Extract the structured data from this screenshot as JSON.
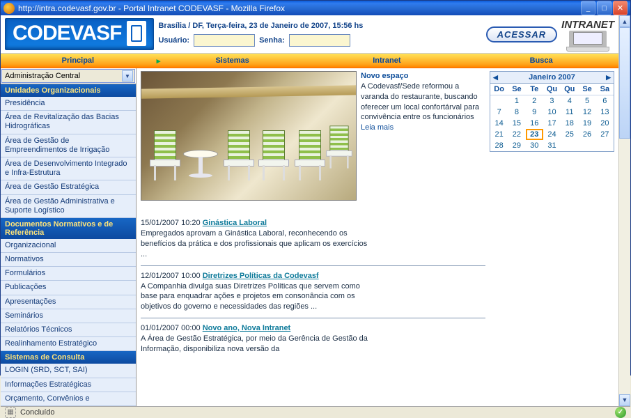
{
  "window": {
    "title": "http://intra.codevasf.gov.br - Portal Intranet CODEVASF - Mozilla Firefox"
  },
  "header": {
    "logo_text": "CODEVASF",
    "location": "Brasília / DF, Terça-feira, 23 de Janeiro de 2007, 15:56 hs",
    "user_label": "Usuário:",
    "pass_label": "Senha:",
    "login_button": "ACESSAR",
    "intranet_tag": "INTRANET"
  },
  "nav": {
    "items": [
      "Principal",
      "Sistemas",
      "Intranet",
      "Busca"
    ]
  },
  "sidebar": {
    "select_value": "Administração Central",
    "sections": [
      {
        "heading": "Unidades Organizacionais",
        "items": [
          "Presidência",
          "Área de Revitalização das Bacias Hidrográficas",
          "Área de Gestão de Empreendimentos de Irrigação",
          "Área de Desenvolvimento Integrado e Infra-Estrutura",
          "Área de Gestão Estratégica",
          "Área de Gestão Administrativa e Suporte Logístico"
        ]
      },
      {
        "heading": "Documentos Normativos e de Referência",
        "items": [
          "Organizacional",
          "Normativos",
          "Formulários",
          "Publicações",
          "Apresentações",
          "Seminários",
          "Relatórios Técnicos",
          "Realinhamento Estratégico"
        ]
      },
      {
        "heading": "Sistemas de Consulta",
        "items": [
          "LOGIN (SRD, SCT, SAI)",
          "Informações Estratégicas",
          "Orçamento, Convênios e"
        ]
      }
    ]
  },
  "lead": {
    "title": "Novo espaço",
    "body": "A Codevasf/Sede reformou a varanda do restaurante, buscando oferecer um local confortárval para convivência entre os funcionários",
    "more": "Leia mais"
  },
  "news": [
    {
      "dt": "15/01/2007 10:20",
      "hl": "Ginástica Laboral",
      "body": "Empregados aprovam a Ginástica Laboral, reconhecendo os benefícios da prática e dos profissionais que aplicam os exercícios ..."
    },
    {
      "dt": "12/01/2007 10:00",
      "hl": "Diretrizes Políticas da Codevasf",
      "body": "A Companhia divulga suas Diretrizes Políticas que servem como base para enquadrar ações e projetos em consonância com os objetivos do governo e necessidades das regiões ..."
    },
    {
      "dt": "01/01/2007 00:00",
      "hl": "Novo ano, Nova Intranet",
      "body": "A Área de Gestão Estratégica, por meio da Gerência de Gestão da Informação, disponibiliza nova versão da"
    }
  ],
  "calendar": {
    "title": "Janeiro 2007",
    "dow": [
      "Do",
      "Se",
      "Te",
      "Qu",
      "Qu",
      "Se",
      "Sa"
    ],
    "weeks": [
      [
        "",
        "1",
        "2",
        "3",
        "4",
        "5",
        "6"
      ],
      [
        "7",
        "8",
        "9",
        "10",
        "11",
        "12",
        "13"
      ],
      [
        "14",
        "15",
        "16",
        "17",
        "18",
        "19",
        "20"
      ],
      [
        "21",
        "22",
        "23",
        "24",
        "25",
        "26",
        "27"
      ],
      [
        "28",
        "29",
        "30",
        "31",
        "",
        "",
        ""
      ]
    ],
    "today": "23"
  },
  "status": {
    "text": "Concluído"
  }
}
